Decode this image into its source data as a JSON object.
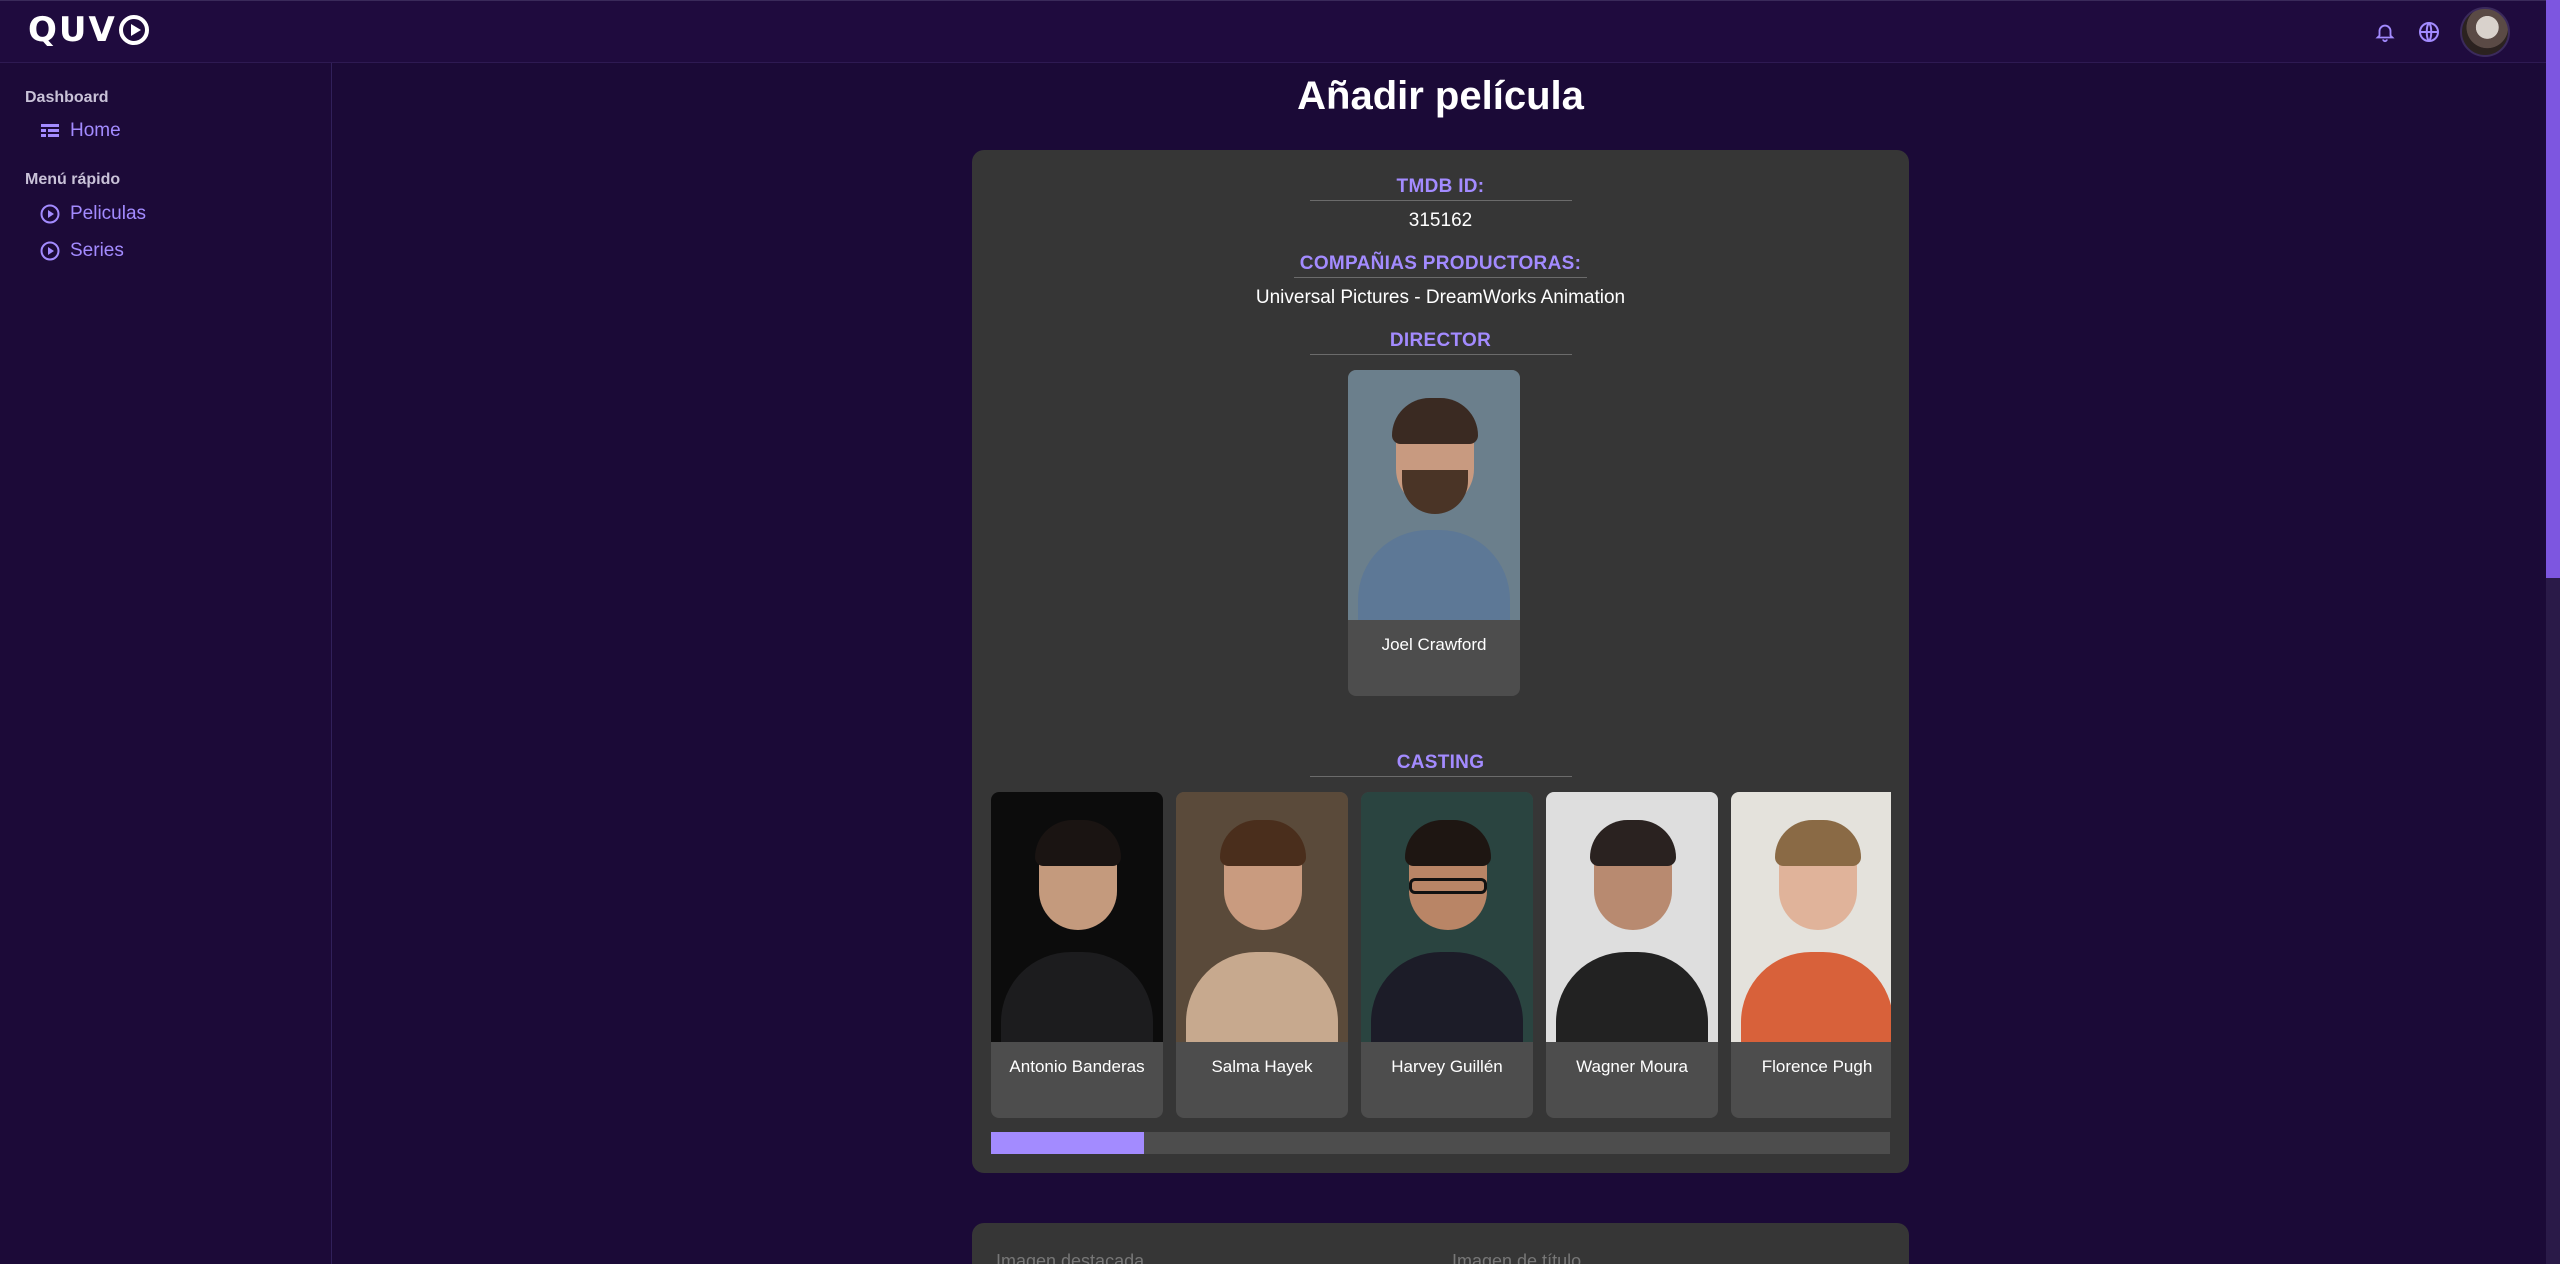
{
  "app": {
    "logo_text": "QUV"
  },
  "sidebar": {
    "sections": [
      {
        "label": "Dashboard",
        "items": [
          {
            "label": "Home",
            "icon": "dashboard-icon"
          }
        ]
      },
      {
        "label": "Menú rápido",
        "items": [
          {
            "label": "Peliculas",
            "icon": "play-circle-icon"
          },
          {
            "label": "Series",
            "icon": "play-circle-icon"
          }
        ]
      }
    ]
  },
  "header": {
    "icons": [
      "bell-icon",
      "globe-icon",
      "avatar"
    ]
  },
  "main": {
    "title": "Añadir película",
    "tmdb": {
      "label": "TMDB ID:",
      "value": "315162"
    },
    "companies": {
      "label": "COMPAÑIAS PRODUCTORAS:",
      "value": "Universal Pictures - DreamWorks Animation"
    },
    "director": {
      "label": "DIRECTOR",
      "name": "Joel Crawford"
    },
    "casting": {
      "label": "CASTING",
      "people": [
        {
          "name": "Antonio Banderas"
        },
        {
          "name": "Salma Hayek"
        },
        {
          "name": "Harvey Guillén"
        },
        {
          "name": "Wagner Moura"
        },
        {
          "name": "Florence Pugh"
        }
      ],
      "scroll_progress": 0.17
    },
    "next_card": {
      "left_label": "Imagen destacada",
      "right_label": "Imagen de título"
    }
  },
  "colors": {
    "accent": "#a38bff",
    "background": "#1b0a37",
    "card": "#363636"
  }
}
